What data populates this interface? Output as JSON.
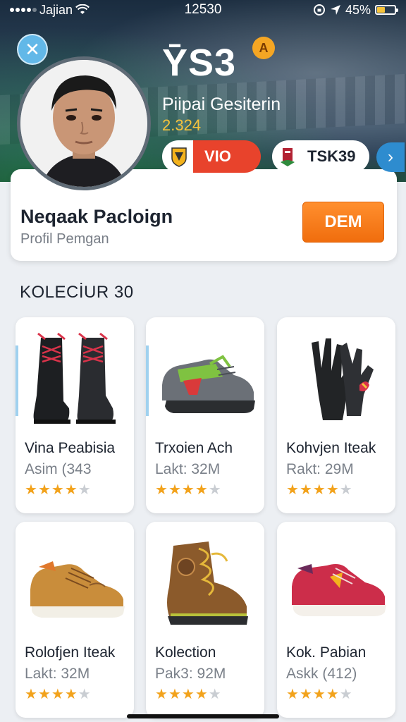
{
  "status_bar": {
    "carrier": "Jajian",
    "time": "12530",
    "battery_percent": "45%",
    "battery_level": 0.45,
    "icons": [
      "signal-icon",
      "wifi-icon",
      "lock-rotation-icon",
      "location-icon",
      "battery-icon"
    ]
  },
  "header": {
    "close_icon": "✕",
    "title": "ȲS3",
    "badge": "A",
    "subtitle": "Piipai Gesiterin",
    "score": "2.324",
    "chips": [
      {
        "label": "VIO",
        "icon": "team-crest-icon"
      },
      {
        "label": "TSK39",
        "icon": "team-logo-icon"
      }
    ],
    "more_icon": "›"
  },
  "profile": {
    "name": "Neqaak Pacloign",
    "subtitle": "Profil Pemgan",
    "action_label": "DEM"
  },
  "collection": {
    "title": "KOLECİUR 30",
    "items": [
      {
        "name": "Vina Peabisia",
        "sub": "Asim (343",
        "rating": 4,
        "max_rating": 5,
        "image": "black-boots"
      },
      {
        "name": "Trxoien Ach",
        "sub": "Lakt: 32M",
        "rating": 4,
        "max_rating": 5,
        "image": "green-sneaker"
      },
      {
        "name": "Kohvjen Iteak",
        "sub": "Rakt: 29M",
        "rating": 4,
        "max_rating": 5,
        "image": "black-gloves"
      },
      {
        "name": "Rolofjen Iteak",
        "sub": "Lakt: 32M",
        "rating": 4,
        "max_rating": 5,
        "image": "tan-shoe"
      },
      {
        "name": "Kolection",
        "sub": "Pak3: 92M",
        "rating": 4,
        "max_rating": 5,
        "image": "brown-boot"
      },
      {
        "name": "Kok. Pabian",
        "sub": "Askk (412)",
        "rating": 4,
        "max_rating": 5,
        "image": "red-sneaker"
      }
    ]
  },
  "colors": {
    "accent_orange": "#f27a14",
    "accent_blue": "#2e8ccf",
    "chip_red": "#e8432c",
    "star": "#f2a21b",
    "score_yellow": "#f6c33c"
  }
}
